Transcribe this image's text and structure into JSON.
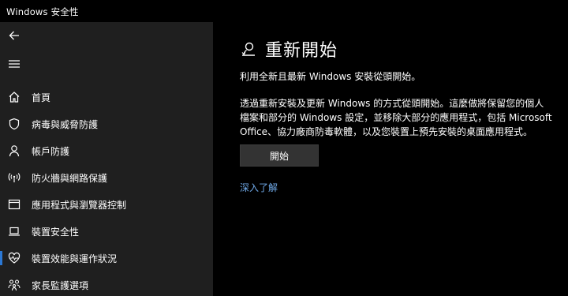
{
  "window": {
    "title": "Windows 安全性"
  },
  "sidebar": {
    "back_icon": "back-arrow-icon",
    "menu_icon": "hamburger-menu-icon",
    "accent_color": "#2b78d4",
    "items": [
      {
        "label": "首頁",
        "icon": "home-icon",
        "selected": false
      },
      {
        "label": "病毒與威脅防護",
        "icon": "shield-icon",
        "selected": false
      },
      {
        "label": "帳戶防護",
        "icon": "person-icon",
        "selected": false
      },
      {
        "label": "防火牆與網路保護",
        "icon": "wifi-signal-icon",
        "selected": false
      },
      {
        "label": "應用程式與瀏覽器控制",
        "icon": "app-window-icon",
        "selected": false
      },
      {
        "label": "裝置安全性",
        "icon": "laptop-icon",
        "selected": false
      },
      {
        "label": "裝置效能與運作狀況",
        "icon": "heart-icon",
        "selected": true
      },
      {
        "label": "家長監護選項",
        "icon": "family-icon",
        "selected": false
      }
    ]
  },
  "main": {
    "heading_icon": "fresh-start-icon",
    "title": "重新開始",
    "subtitle": "利用全新且最新 Windows 安裝從頭開始。",
    "description": "透過重新安裝及更新 Windows 的方式從頭開始。這麼做將保留您的個人\n檔案和部分的 Windows 設定，並移除大部分的應用程式，包括 Microsoft\nOffice、協力廠商防毒軟體，以及您裝置上預先安裝的桌面應用程式。",
    "start_button": "開始",
    "learn_more_link": "深入了解",
    "link_color": "#6fa9e8"
  }
}
